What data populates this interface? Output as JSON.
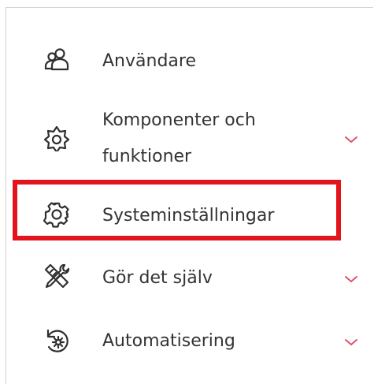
{
  "menu": {
    "items": [
      {
        "label": "Användare",
        "icon": "user-group-icon",
        "expandable": false
      },
      {
        "label": "Komponenter och funktioner",
        "icon": "flower-gear-icon",
        "expandable": true
      },
      {
        "label": "Systeminställningar",
        "icon": "gear-icon",
        "expandable": false,
        "highlighted": true
      },
      {
        "label": "Gör det själv",
        "icon": "tools-icon",
        "expandable": true
      },
      {
        "label": "Automatisering",
        "icon": "automation-icon",
        "expandable": true
      }
    ]
  },
  "colors": {
    "text": "#333333",
    "chevron": "#e0506a",
    "highlight": "#e3141c",
    "border": "#d4d4d4"
  }
}
